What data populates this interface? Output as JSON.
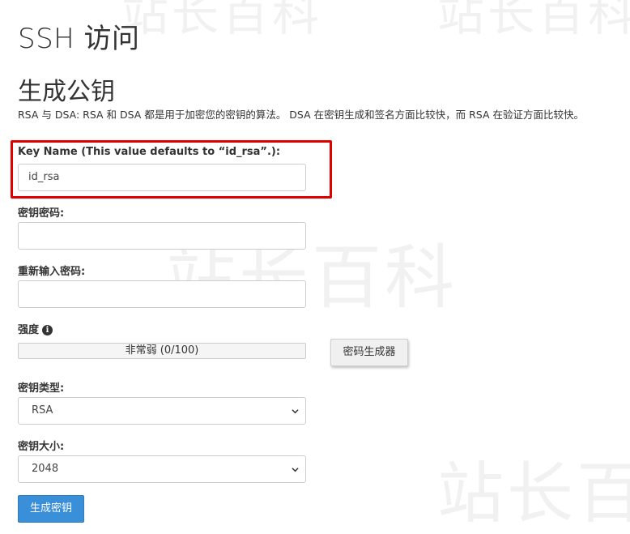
{
  "page": {
    "title": "SSH 访问"
  },
  "section": {
    "title": "生成公钥",
    "description": "RSA 与 DSA: RSA 和 DSA 都是用于加密您的密钥的算法。 DSA 在密钥生成和签名方面比较快，而 RSA 在验证方面比较快。"
  },
  "form": {
    "key_name": {
      "label": "Key Name (This value defaults to “id_rsa”.):",
      "value": "id_rsa"
    },
    "passphrase": {
      "label": "密钥密码:",
      "value": ""
    },
    "passphrase_confirm": {
      "label": "重新输入密码:",
      "value": ""
    },
    "strength": {
      "label": "强度",
      "info_icon": "info-circle-icon",
      "text": "非常弱 (0/100)",
      "score": 0,
      "max": 100
    },
    "password_generator_label": "密码生成器",
    "key_type": {
      "label": "密钥类型:",
      "selected": "RSA"
    },
    "key_size": {
      "label": "密钥大小:",
      "selected": "2048"
    },
    "submit_label": "生成密钥"
  },
  "colors": {
    "highlight": "#e00000",
    "primary": "#3a8fd9",
    "strength_low": "#d9534f"
  }
}
